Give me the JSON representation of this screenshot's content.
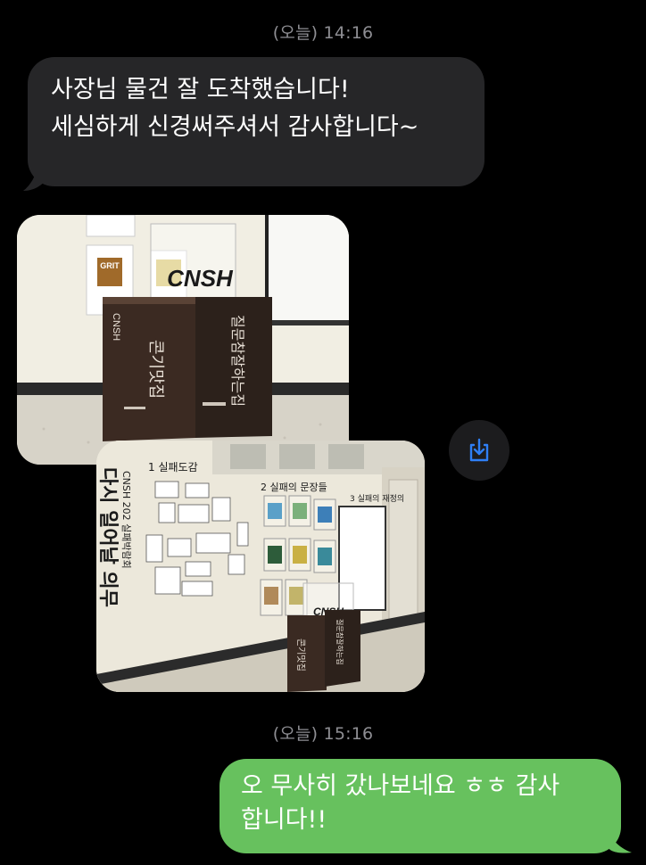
{
  "messages": {
    "timestamp_1": "(오늘) 14:16",
    "incoming_line_1": "사장님 물건 잘 도착했습니다!",
    "incoming_line_2": "세심하게 신경써주셔서 감사합니다~",
    "timestamp_2": "(오늘) 15:16",
    "outgoing_line_1": "오 무사히 갔나보네요 ㅎㅎ 감사",
    "outgoing_line_2": "합니다!!"
  },
  "photo_1": {
    "logo_text": "CNSH",
    "box_left_vertical": "CNSH",
    "box_left_title": "콘기맛집",
    "box_right_title": "질문참잘하는집",
    "poster_text": "GRIT"
  },
  "photo_2": {
    "section_1": "1 실패도감",
    "section_2": "2 실패의 문장들",
    "section_3": "3 실패의 재정의",
    "vertical_title": "다시 일어날 의무",
    "vertical_sub": "CNSH 202 실패박람회",
    "logo_text": "CNSH",
    "box_left_title": "콘기맛집",
    "box_right_title": "질문참잘하는집"
  },
  "icons": {
    "save": "save-download-icon"
  },
  "colors": {
    "background": "#000000",
    "incoming_bubble": "#262628",
    "outgoing_bubble": "#67c15e",
    "timestamp": "#8e8e93",
    "save_icon": "#2f7ff5"
  }
}
